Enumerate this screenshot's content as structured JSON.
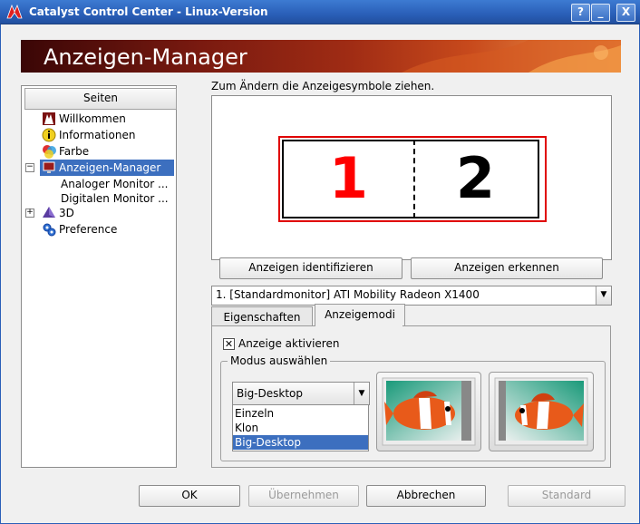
{
  "window": {
    "title": "Catalyst Control Center - Linux-Version",
    "controls": {
      "help": "?",
      "minimize": "_",
      "close": "X"
    }
  },
  "banner": {
    "title": "Anzeigen-Manager"
  },
  "sidebar": {
    "header": "Seiten",
    "items": [
      {
        "label": "Willkommen",
        "icon": "welcome-icon"
      },
      {
        "label": "Informationen",
        "icon": "info-icon"
      },
      {
        "label": "Farbe",
        "icon": "color-icon"
      },
      {
        "label": "Anzeigen-Manager",
        "icon": "display-manager-icon",
        "expander": "−",
        "selected": true
      },
      {
        "label": "Analoger Monitor ...",
        "child": true
      },
      {
        "label": "Digitalen Monitor ...",
        "child": true
      },
      {
        "label": "3D",
        "icon": "3d-icon",
        "expander": "+"
      },
      {
        "label": "Preference",
        "icon": "preference-icon"
      }
    ]
  },
  "main": {
    "instruction": "Zum Ändern die Anzeigesymbole ziehen.",
    "displays": [
      {
        "number": "1",
        "color": "#ff0000"
      },
      {
        "number": "2",
        "color": "#000000"
      }
    ],
    "identify_button": "Anzeigen identifizieren",
    "detect_button": "Anzeigen erkennen",
    "monitor_select": "1.  [Standardmonitor] ATI Mobility Radeon X1400",
    "tabs": [
      {
        "label": "Eigenschaften",
        "active": false
      },
      {
        "label": "Anzeigemodi",
        "active": true
      }
    ],
    "enable_display": {
      "label": "Anzeige aktivieren",
      "checked": true
    },
    "mode_group": {
      "legend": "Modus auswählen",
      "selected": "Big-Desktop",
      "options": [
        "Einzeln",
        "Klon",
        "Big-Desktop"
      ]
    }
  },
  "footer": {
    "ok": "OK",
    "apply": "Übernehmen",
    "cancel": "Abbrechen",
    "default": "Standard"
  },
  "colors": {
    "titlebar": "#2a5fb8",
    "selection": "#3c6fbf",
    "display_border": "#e00000"
  }
}
